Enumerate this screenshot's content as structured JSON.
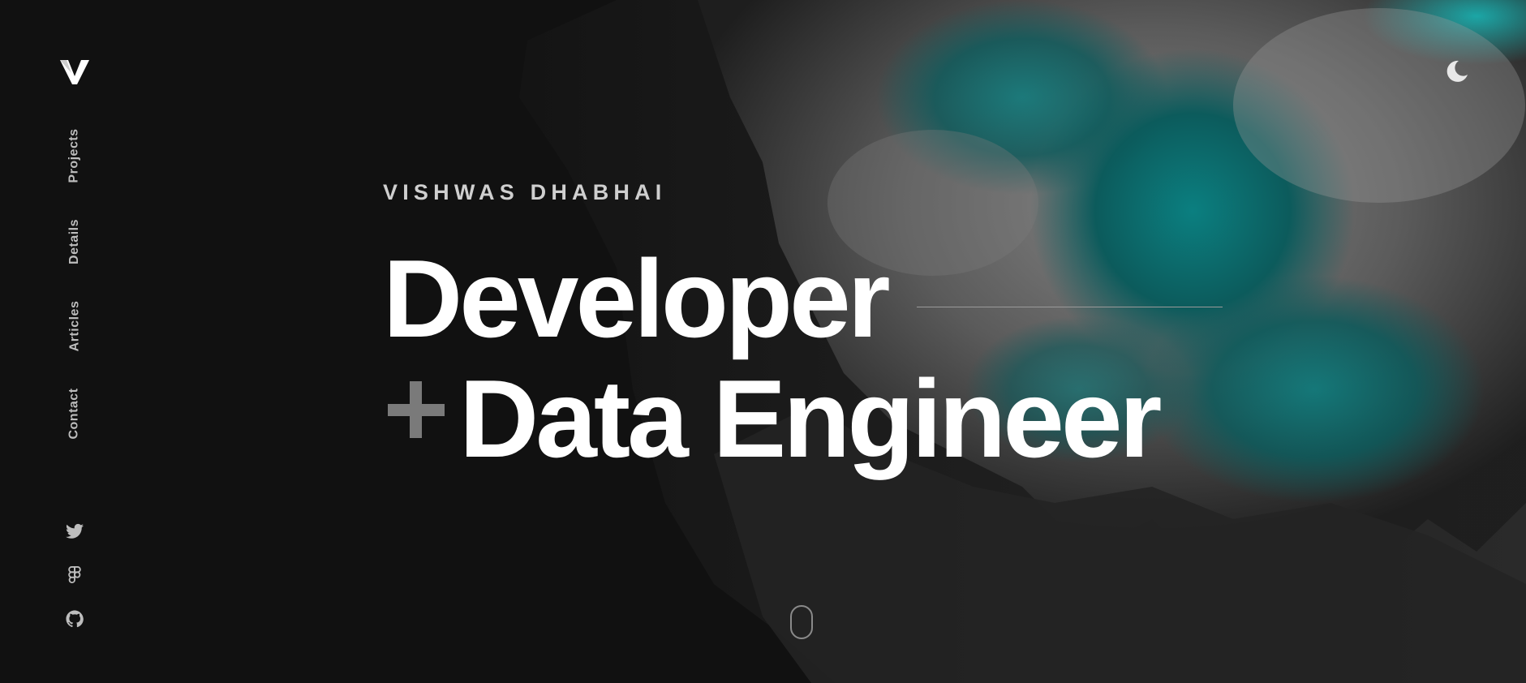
{
  "brand": {
    "logo_icon": "v-monogram-logo"
  },
  "nav": {
    "items": [
      {
        "label": "Projects"
      },
      {
        "label": "Details"
      },
      {
        "label": "Articles"
      },
      {
        "label": "Contact"
      }
    ]
  },
  "social": {
    "items": [
      {
        "icon": "twitter-icon"
      },
      {
        "icon": "figma-icon"
      },
      {
        "icon": "github-icon"
      }
    ]
  },
  "header": {
    "theme_toggle_icon": "moon-icon"
  },
  "hero": {
    "name": "VISHWAS DHABHAI",
    "line1": "Developer",
    "line2_prefix": "+",
    "line2": "Data Engineer"
  },
  "colors": {
    "background": "#111111",
    "accent_teal": "#0f8a8a",
    "text_primary": "#ffffff",
    "text_muted": "#bdbdbd"
  }
}
